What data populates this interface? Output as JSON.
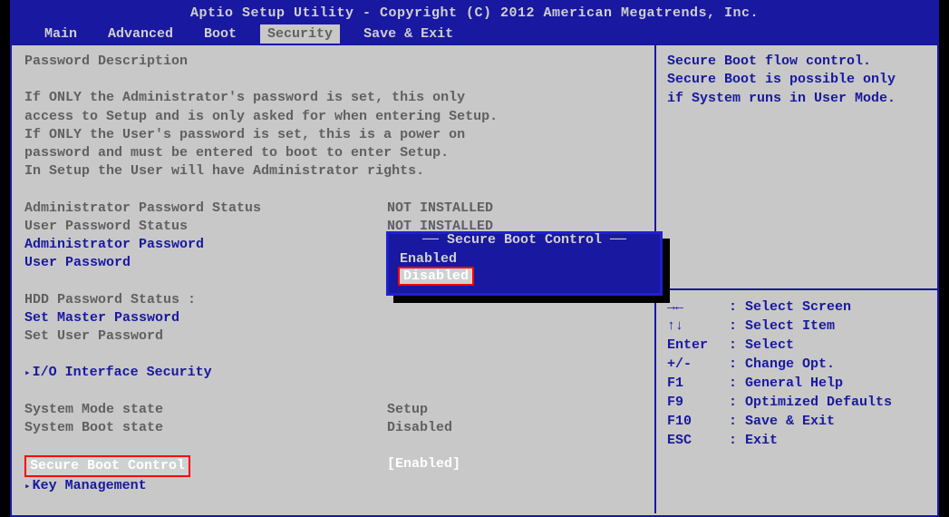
{
  "header": {
    "title": "Aptio Setup Utility - Copyright (C) 2012 American Megatrends, Inc."
  },
  "tabs": {
    "main": "Main",
    "advanced": "Advanced",
    "boot": "Boot",
    "security": "Security",
    "save_exit": "Save & Exit"
  },
  "left": {
    "pw_desc_title": "Password Description",
    "pw_desc_body": "If ONLY the Administrator's password is set, this only\naccess to Setup and is only asked for when entering Setup.\nIf ONLY the User's password is set, this is a power on\npassword and must be entered to boot to enter Setup.\nIn Setup the User will have Administrator rights.",
    "admin_pw_status_label": "Administrator Password Status",
    "admin_pw_status_value": "NOT INSTALLED",
    "user_pw_status_label": "User Password Status",
    "user_pw_status_value": "NOT INSTALLED",
    "admin_pw_label": "Administrator Password",
    "user_pw_label": "User Password",
    "hdd_pw_status_label": "HDD Password Status  :",
    "set_master_pw_label": "Set Master Password",
    "set_user_pw_label": "Set User Password",
    "io_interface_label": "I/O Interface Security",
    "sys_mode_label": "System Mode state",
    "sys_mode_value": "Setup",
    "sys_boot_label": "System Boot state",
    "sys_boot_value": "Disabled",
    "secure_boot_label": "Secure Boot Control",
    "secure_boot_value": "[Enabled]",
    "key_mgmt_label": "Key Management"
  },
  "popup": {
    "title": "Secure Boot Control",
    "option_enabled": "Enabled",
    "option_disabled": "Disabled"
  },
  "help_top": "Secure Boot flow control.\nSecure Boot is possible only\nif System runs in User Mode.",
  "keys": {
    "k1": "→←",
    "v1": ": Select Screen",
    "k2": "↑↓",
    "v2": ": Select Item",
    "k3": "Enter",
    "v3": ": Select",
    "k4": "+/-",
    "v4": ": Change Opt.",
    "k5": "F1",
    "v5": ": General Help",
    "k6": "F9",
    "v6": ": Optimized Defaults",
    "k7": "F10",
    "v7": ": Save & Exit",
    "k8": "ESC",
    "v8": ": Exit"
  }
}
